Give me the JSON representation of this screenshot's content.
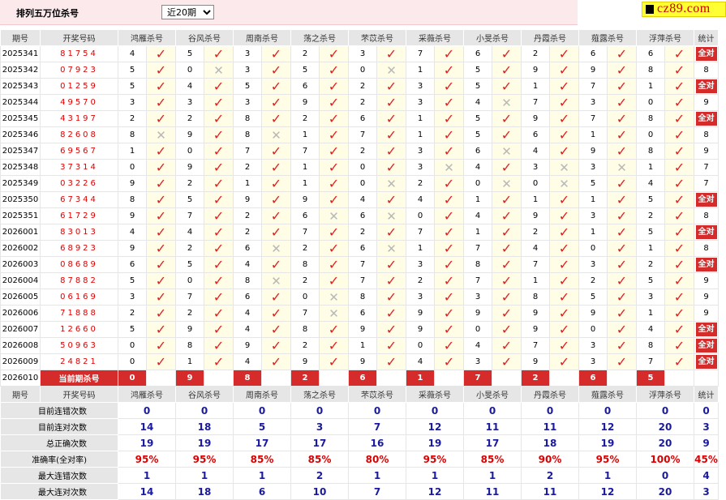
{
  "header": {
    "title": "排列五万位杀号",
    "period_select": "近20期"
  },
  "logo": {
    "text": "cz89.com"
  },
  "columns": [
    "期号",
    "开奖号码",
    "鸿雁杀号",
    "谷风杀号",
    "周南杀号",
    "荡之杀号",
    "芣苡杀号",
    "采薇杀号",
    "小旻杀号",
    "丹霞杀号",
    "薤露杀号",
    "浮萍杀号",
    "统计"
  ],
  "all_right_label": "全对",
  "rows": [
    {
      "issue": "2025341",
      "draw": "81754",
      "k": [
        "4",
        "5",
        "3",
        "2",
        "3",
        "7",
        "6",
        "2",
        "6",
        "6"
      ],
      "r": [
        1,
        1,
        1,
        1,
        1,
        1,
        1,
        1,
        1,
        1
      ],
      "stat": "全对"
    },
    {
      "issue": "2025342",
      "draw": "07923",
      "k": [
        "5",
        "0",
        "3",
        "5",
        "0",
        "1",
        "5",
        "9",
        "9",
        "8"
      ],
      "r": [
        1,
        0,
        1,
        1,
        0,
        1,
        1,
        1,
        1,
        1
      ],
      "stat": "8"
    },
    {
      "issue": "2025343",
      "draw": "01259",
      "k": [
        "5",
        "4",
        "5",
        "6",
        "2",
        "3",
        "5",
        "1",
        "7",
        "1"
      ],
      "r": [
        1,
        1,
        1,
        1,
        1,
        1,
        1,
        1,
        1,
        1
      ],
      "stat": "全对"
    },
    {
      "issue": "2025344",
      "draw": "49570",
      "k": [
        "3",
        "3",
        "3",
        "9",
        "2",
        "3",
        "4",
        "7",
        "3",
        "0"
      ],
      "r": [
        1,
        1,
        1,
        1,
        1,
        1,
        0,
        1,
        1,
        1
      ],
      "stat": "9"
    },
    {
      "issue": "2025345",
      "draw": "43197",
      "k": [
        "2",
        "2",
        "8",
        "2",
        "6",
        "1",
        "5",
        "9",
        "7",
        "8"
      ],
      "r": [
        1,
        1,
        1,
        1,
        1,
        1,
        1,
        1,
        1,
        1
      ],
      "stat": "全对"
    },
    {
      "issue": "2025346",
      "draw": "82608",
      "k": [
        "8",
        "9",
        "8",
        "1",
        "7",
        "1",
        "5",
        "6",
        "1",
        "0"
      ],
      "r": [
        0,
        1,
        0,
        1,
        1,
        1,
        1,
        1,
        1,
        1
      ],
      "stat": "8"
    },
    {
      "issue": "2025347",
      "draw": "69567",
      "k": [
        "1",
        "0",
        "7",
        "7",
        "2",
        "3",
        "6",
        "4",
        "9",
        "8"
      ],
      "r": [
        1,
        1,
        1,
        1,
        1,
        1,
        0,
        1,
        1,
        1
      ],
      "stat": "9"
    },
    {
      "issue": "2025348",
      "draw": "37314",
      "k": [
        "0",
        "9",
        "2",
        "1",
        "0",
        "3",
        "4",
        "3",
        "3",
        "1"
      ],
      "r": [
        1,
        1,
        1,
        1,
        1,
        0,
        1,
        0,
        0,
        1
      ],
      "stat": "7"
    },
    {
      "issue": "2025349",
      "draw": "03226",
      "k": [
        "9",
        "2",
        "1",
        "1",
        "0",
        "2",
        "0",
        "0",
        "5",
        "4"
      ],
      "r": [
        1,
        1,
        1,
        1,
        0,
        1,
        0,
        0,
        1,
        1
      ],
      "stat": "7"
    },
    {
      "issue": "2025350",
      "draw": "67344",
      "k": [
        "8",
        "5",
        "9",
        "9",
        "4",
        "4",
        "1",
        "1",
        "1",
        "5"
      ],
      "r": [
        1,
        1,
        1,
        1,
        1,
        1,
        1,
        1,
        1,
        1
      ],
      "stat": "全对"
    },
    {
      "issue": "2025351",
      "draw": "61729",
      "k": [
        "9",
        "7",
        "2",
        "6",
        "6",
        "0",
        "4",
        "9",
        "3",
        "2"
      ],
      "r": [
        1,
        1,
        1,
        0,
        0,
        1,
        1,
        1,
        1,
        1
      ],
      "stat": "8"
    },
    {
      "issue": "2026001",
      "draw": "83013",
      "k": [
        "4",
        "4",
        "2",
        "7",
        "2",
        "7",
        "1",
        "2",
        "1",
        "5"
      ],
      "r": [
        1,
        1,
        1,
        1,
        1,
        1,
        1,
        1,
        1,
        1
      ],
      "stat": "全对"
    },
    {
      "issue": "2026002",
      "draw": "68923",
      "k": [
        "9",
        "2",
        "6",
        "2",
        "6",
        "1",
        "7",
        "4",
        "0",
        "1"
      ],
      "r": [
        1,
        1,
        0,
        1,
        0,
        1,
        1,
        1,
        1,
        1
      ],
      "stat": "8"
    },
    {
      "issue": "2026003",
      "draw": "08689",
      "k": [
        "6",
        "5",
        "4",
        "8",
        "7",
        "3",
        "8",
        "7",
        "3",
        "2"
      ],
      "r": [
        1,
        1,
        1,
        1,
        1,
        1,
        1,
        1,
        1,
        1
      ],
      "stat": "全对"
    },
    {
      "issue": "2026004",
      "draw": "87882",
      "k": [
        "5",
        "0",
        "8",
        "2",
        "7",
        "2",
        "7",
        "1",
        "2",
        "5"
      ],
      "r": [
        1,
        1,
        0,
        1,
        1,
        1,
        1,
        1,
        1,
        1
      ],
      "stat": "9"
    },
    {
      "issue": "2026005",
      "draw": "06169",
      "k": [
        "3",
        "7",
        "6",
        "0",
        "8",
        "3",
        "3",
        "8",
        "5",
        "3"
      ],
      "r": [
        1,
        1,
        1,
        0,
        1,
        1,
        1,
        1,
        1,
        1
      ],
      "stat": "9"
    },
    {
      "issue": "2026006",
      "draw": "71888",
      "k": [
        "2",
        "2",
        "4",
        "7",
        "6",
        "9",
        "9",
        "9",
        "9",
        "1"
      ],
      "r": [
        1,
        1,
        1,
        0,
        1,
        1,
        1,
        1,
        1,
        1
      ],
      "stat": "9"
    },
    {
      "issue": "2026007",
      "draw": "12660",
      "k": [
        "5",
        "9",
        "4",
        "8",
        "9",
        "9",
        "0",
        "9",
        "0",
        "4"
      ],
      "r": [
        1,
        1,
        1,
        1,
        1,
        1,
        1,
        1,
        1,
        1
      ],
      "stat": "全对"
    },
    {
      "issue": "2026008",
      "draw": "50963",
      "k": [
        "0",
        "8",
        "9",
        "2",
        "1",
        "0",
        "4",
        "7",
        "3",
        "8"
      ],
      "r": [
        1,
        1,
        1,
        1,
        1,
        1,
        1,
        1,
        1,
        1
      ],
      "stat": "全对"
    },
    {
      "issue": "2026009",
      "draw": "24821",
      "k": [
        "0",
        "1",
        "4",
        "9",
        "9",
        "4",
        "3",
        "9",
        "3",
        "7"
      ],
      "r": [
        1,
        1,
        1,
        1,
        1,
        1,
        1,
        1,
        1,
        1
      ],
      "stat": "全对"
    }
  ],
  "current": {
    "issue": "2026010",
    "label": "当前期杀号",
    "kills": [
      "0",
      "9",
      "8",
      "2",
      "6",
      "1",
      "7",
      "2",
      "6",
      "5"
    ]
  },
  "summary": [
    {
      "label": "目前连错次数",
      "values": [
        "0",
        "0",
        "0",
        "0",
        "0",
        "0",
        "0",
        "0",
        "0",
        "0",
        "0"
      ],
      "color": "blue"
    },
    {
      "label": "目前连对次数",
      "values": [
        "14",
        "18",
        "5",
        "3",
        "7",
        "12",
        "11",
        "11",
        "12",
        "20",
        "3"
      ],
      "color": "blue"
    },
    {
      "label": "总正确次数",
      "values": [
        "19",
        "19",
        "17",
        "17",
        "16",
        "19",
        "17",
        "18",
        "19",
        "20",
        "9"
      ],
      "color": "blue"
    },
    {
      "label": "准确率(全对率)",
      "values": [
        "95%",
        "95%",
        "85%",
        "85%",
        "80%",
        "95%",
        "85%",
        "90%",
        "95%",
        "100%",
        "45%"
      ],
      "color": "red"
    },
    {
      "label": "最大连错次数",
      "values": [
        "1",
        "1",
        "1",
        "2",
        "1",
        "1",
        "1",
        "2",
        "1",
        "0",
        "4"
      ],
      "color": "blue"
    },
    {
      "label": "最大连对次数",
      "values": [
        "14",
        "18",
        "6",
        "10",
        "7",
        "12",
        "11",
        "11",
        "12",
        "20",
        "3"
      ],
      "color": "blue"
    }
  ],
  "marks": {
    "ok_icon": "check-icon",
    "bad_icon": "cross-icon",
    "ok_color": "#e02020",
    "bad_color": "#b8b8b8",
    "accent": "#d62b2b"
  }
}
